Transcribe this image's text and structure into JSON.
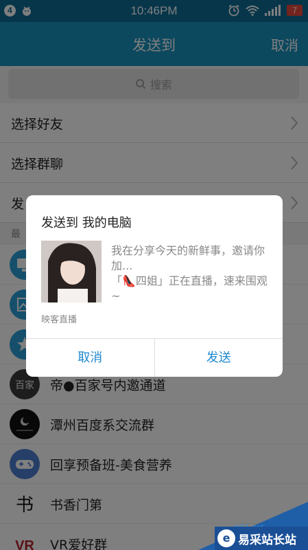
{
  "status_bar": {
    "time": "10:46PM",
    "notif_count": "4",
    "battery": "7"
  },
  "header": {
    "title": "发送到",
    "cancel": "取消"
  },
  "search": {
    "placeholder": "搜索"
  },
  "menu": [
    {
      "label": "选择好友"
    },
    {
      "label": "选择群聊"
    },
    {
      "label": "发"
    }
  ],
  "section_header": "最",
  "contacts": [
    {
      "name": "帝●百家号内邀通道",
      "avatar_text": "百家"
    },
    {
      "name": "潭州百度系交流群"
    },
    {
      "name": "回享预备班-美食营养"
    },
    {
      "name": "书香门第",
      "avatar_text": "书"
    },
    {
      "name": "VR爱好群",
      "avatar_text": "VR"
    }
  ],
  "dialog": {
    "title": "发送到 我的电脑",
    "description_line1": "我在分享今天的新鲜事，邀请你加...",
    "description_line2": "「👠四姐」正在直播，速来围观~",
    "source": "映客直播",
    "cancel": "取消",
    "send": "发送"
  },
  "watermark": {
    "text": "易采站长站",
    "url": "jb51.net"
  },
  "colors": {
    "header_bg": "#1990bd",
    "status_bg": "#0e6d96",
    "accent": "#1e88d0"
  }
}
